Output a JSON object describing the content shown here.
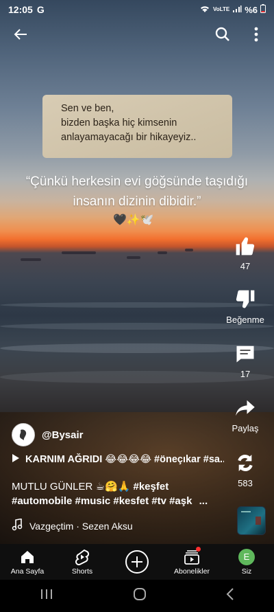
{
  "status": {
    "time": "12:05",
    "battery": "%6",
    "network": "VoLTE"
  },
  "note_lines": [
    "Sen ve ben,",
    "bizden başka hiç kimsenin",
    "anlayamayacağı bir hikayeyiz.."
  ],
  "quote_lines": [
    "“Çünkü herkesin evi göğsünde taşıdığı",
    "insanın dizinin dibidir.”"
  ],
  "quote_emoji": "🖤✨🕊️",
  "rail": {
    "likes": "47",
    "dislike_label": "Beğenme",
    "comments": "17",
    "share_label": "Paylaş",
    "remix": "583"
  },
  "channel": {
    "handle": "@Bysair"
  },
  "playlist_text": "KARNIM AĞRIDI 😂😂😂😂 #öneçıkar #sa...",
  "caption": {
    "text": "MUTLU GÜNLER ☕🤗🙏 ",
    "tags1": "#keşfet",
    "tags2": "#automobile #music #kesfet #tv #aşk",
    "more": "..."
  },
  "music": {
    "label": "Vazgeçtim · Sezen Aksu"
  },
  "nav": {
    "home": "Ana Sayfa",
    "shorts": "Shorts",
    "subs": "Abonelikler",
    "you": "Siz",
    "user_initial": "E"
  },
  "colors": {
    "accent_red": "#ff2f2f",
    "nav_bg": "#0f0f0f",
    "user_green": "#5fb85c"
  }
}
